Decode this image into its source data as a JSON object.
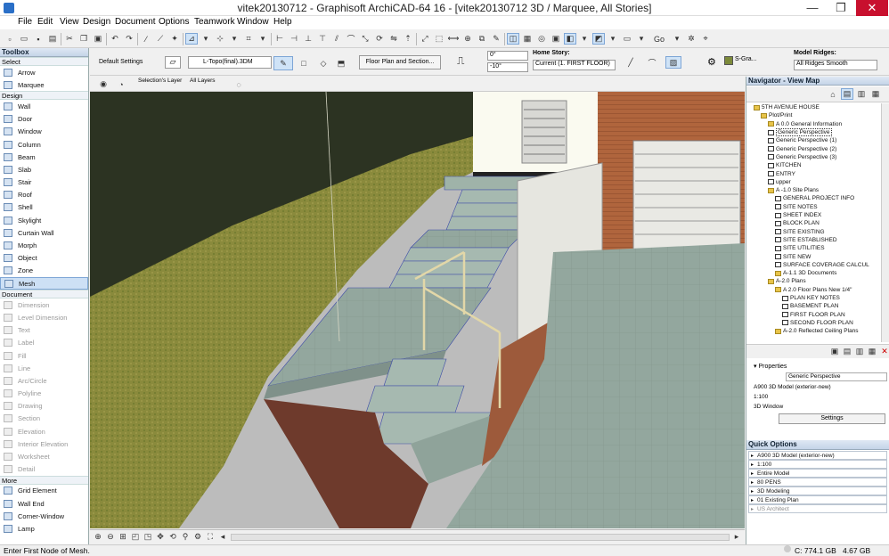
{
  "window": {
    "title": "vitek20130712 - Graphisoft ArchiCAD-64 16 - [vitek20130712 3D / Marquee, All Stories]",
    "minimize": "—",
    "maximize": "❐",
    "close": "✕"
  },
  "menu": [
    "File",
    "Edit",
    "View",
    "Design",
    "Document",
    "Options",
    "Teamwork",
    "Window",
    "Help"
  ],
  "toolbar": {
    "goto_label": "Go"
  },
  "infobox": {
    "default_settings": "Default Settings",
    "layer": "L-Topo(final).3DM",
    "floor_plan_section": "Floor Plan and Section...",
    "angle1": "0°",
    "angle2": "-10°",
    "home_story_label": "Home Story:",
    "home_story_value": "Current (1. FIRST FLOOR)",
    "material": "S-Gra...",
    "model_ridges_label": "Model Ridges:",
    "model_ridges_value": "All Ridges Smooth"
  },
  "view_toolbar": {
    "selections_layer": "Selection's Layer",
    "all_layers": "All Layers"
  },
  "toolbox": {
    "title": "Toolbox",
    "select_label": "Select",
    "select_tools": [
      "Arrow",
      "Marquee"
    ],
    "design_label": "Design",
    "design_tools": [
      "Wall",
      "Door",
      "Window",
      "Column",
      "Beam",
      "Slab",
      "Stair",
      "Roof",
      "Shell",
      "Skylight",
      "Curtain Wall",
      "Morph",
      "Object",
      "Zone",
      "Mesh"
    ],
    "selected_tool": "Mesh",
    "document_label": "Document",
    "document_tools": [
      "Dimension",
      "Level Dimension",
      "Text",
      "Label",
      "Fill",
      "Line",
      "Arc/Circle",
      "Polyline",
      "Drawing",
      "Section",
      "Elevation",
      "Interior Elevation",
      "Worksheet",
      "Detail"
    ],
    "more_label": "More",
    "more_tools": [
      "Grid Element",
      "Wall End",
      "Corner-Window",
      "Lamp"
    ]
  },
  "navigator": {
    "title": "Navigator - View Map",
    "tree": [
      {
        "label": "5TH AVENUE HOUSE",
        "level": 0,
        "type": "project"
      },
      {
        "label": "Plot/Print",
        "level": 1,
        "type": "folder"
      },
      {
        "label": "A 0.0 General Information",
        "level": 2,
        "type": "folder"
      },
      {
        "label": "Generic Perspective",
        "level": 2,
        "type": "view",
        "selected": true
      },
      {
        "label": "Generic Perspective (1)",
        "level": 2,
        "type": "view"
      },
      {
        "label": "Generic Perspective (2)",
        "level": 2,
        "type": "view"
      },
      {
        "label": "Generic Perspective (3)",
        "level": 2,
        "type": "view"
      },
      {
        "label": "KITCHEN",
        "level": 2,
        "type": "view"
      },
      {
        "label": "ENTRY",
        "level": 2,
        "type": "view"
      },
      {
        "label": "upper",
        "level": 2,
        "type": "view"
      },
      {
        "label": "A -1.0 Site Plans",
        "level": 2,
        "type": "folder"
      },
      {
        "label": "GENERAL PROJECT INFO",
        "level": 3,
        "type": "view"
      },
      {
        "label": "SITE NOTES",
        "level": 3,
        "type": "view"
      },
      {
        "label": "SHEET INDEX",
        "level": 3,
        "type": "view"
      },
      {
        "label": "BLOCK PLAN",
        "level": 3,
        "type": "view"
      },
      {
        "label": "SITE EXISTING",
        "level": 3,
        "type": "view"
      },
      {
        "label": "SITE ESTABLISHED",
        "level": 3,
        "type": "view"
      },
      {
        "label": "SITE UTILITIES",
        "level": 3,
        "type": "view"
      },
      {
        "label": "SITE NEW",
        "level": 3,
        "type": "view"
      },
      {
        "label": "SURFACE COVERAGE CALCUL",
        "level": 3,
        "type": "view"
      },
      {
        "label": "A-1.1 3D Documents",
        "level": 3,
        "type": "folder"
      },
      {
        "label": "A-2.0 Plans",
        "level": 2,
        "type": "folder"
      },
      {
        "label": "A 2.0 Floor Plans New 1/4\"",
        "level": 3,
        "type": "folder"
      },
      {
        "label": "PLAN KEY NOTES",
        "level": 4,
        "type": "view"
      },
      {
        "label": "BASEMENT PLAN",
        "level": 4,
        "type": "view"
      },
      {
        "label": "FIRST FLOOR PLAN",
        "level": 4,
        "type": "view"
      },
      {
        "label": "SECOND FLOOR PLAN",
        "level": 4,
        "type": "view"
      },
      {
        "label": "A-2.0 Reflected Ceiling Plans",
        "level": 3,
        "type": "folder"
      }
    ],
    "properties_label": "Properties",
    "prop_name": "Generic Perspective",
    "prop_model": "A900 3D Model (exterior-new)",
    "prop_scale": "1:100",
    "prop_window": "3D Window",
    "settings_button": "Settings",
    "quick_options_label": "Quick Options",
    "quick_options": [
      "A900 3D Model (exterior-new)",
      "1:100",
      "Entire Model",
      "80 PENS",
      "3D Modeling",
      "01 Existing Plan",
      "US Architect"
    ]
  },
  "status": {
    "message": "Enter First Node of Mesh.",
    "disk": "C: 774.1 GB",
    "memory": "4.67 GB"
  }
}
